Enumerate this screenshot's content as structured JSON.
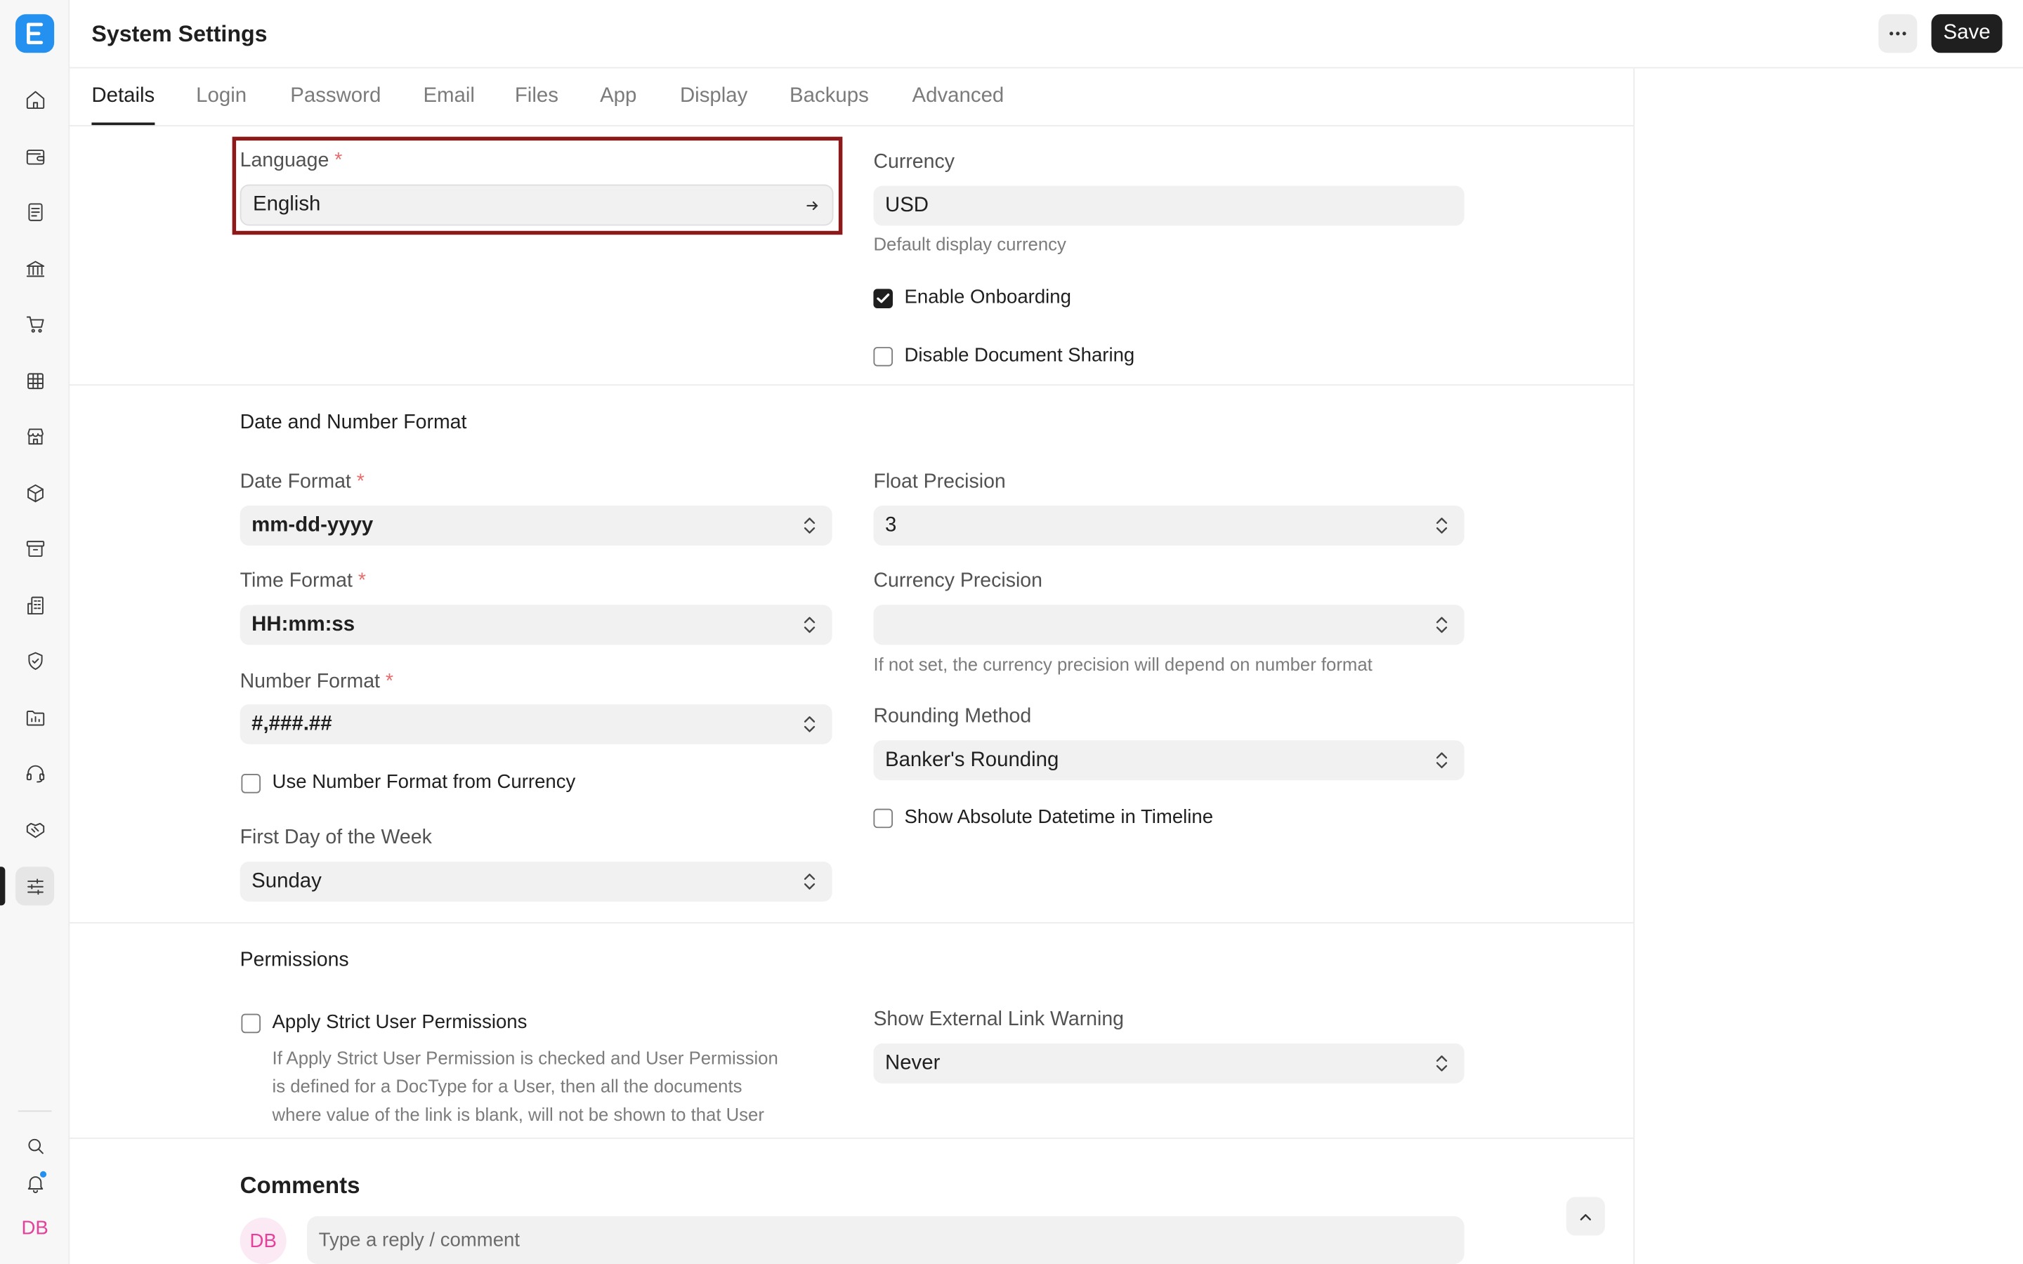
{
  "header": {
    "title": "System Settings",
    "more_label": "···",
    "save_label": "Save"
  },
  "sidebar": {
    "items": [
      {
        "icon": "home-icon"
      },
      {
        "icon": "wallet-icon"
      },
      {
        "icon": "document-icon"
      },
      {
        "icon": "bank-icon"
      },
      {
        "icon": "cart-icon"
      },
      {
        "icon": "table-icon"
      },
      {
        "icon": "store-icon"
      },
      {
        "icon": "package-icon"
      },
      {
        "icon": "archive-icon"
      },
      {
        "icon": "building-icon"
      },
      {
        "icon": "shield-icon"
      },
      {
        "icon": "folder-chart-icon"
      },
      {
        "icon": "headset-icon"
      },
      {
        "icon": "handshake-icon"
      },
      {
        "icon": "settings-sliders-icon",
        "active": true
      }
    ],
    "bottom": [
      "search-icon",
      "bell-icon"
    ],
    "user_initials": "DB"
  },
  "tabs": [
    "Details",
    "Login",
    "Password",
    "Email",
    "Files",
    "App",
    "Display",
    "Backups",
    "Advanced"
  ],
  "active_tab": "Details",
  "details": {
    "language": {
      "label": "Language",
      "required": "*",
      "value": "English"
    },
    "currency": {
      "label": "Currency",
      "value": "USD",
      "help": "Default display currency"
    },
    "enable_onboarding": {
      "label": "Enable Onboarding",
      "checked": true
    },
    "disable_document_sharing": {
      "label": "Disable Document Sharing",
      "checked": false
    }
  },
  "date_number_format": {
    "title": "Date and Number Format",
    "date_format": {
      "label": "Date Format",
      "required": "*",
      "value": "mm-dd-yyyy"
    },
    "time_format": {
      "label": "Time Format",
      "required": "*",
      "value": "HH:mm:ss"
    },
    "number_format": {
      "label": "Number Format",
      "required": "*",
      "value": "#,###.##"
    },
    "use_number_format_from_currency": {
      "label": "Use Number Format from Currency",
      "checked": false
    },
    "first_day_of_week": {
      "label": "First Day of the Week",
      "value": "Sunday"
    },
    "float_precision": {
      "label": "Float Precision",
      "value": "3"
    },
    "currency_precision": {
      "label": "Currency Precision",
      "value": "",
      "help": "If not set, the currency precision will depend on number format"
    },
    "rounding_method": {
      "label": "Rounding Method",
      "value": "Banker's Rounding"
    },
    "show_absolute_datetime": {
      "label": "Show Absolute Datetime in Timeline",
      "checked": false
    }
  },
  "permissions": {
    "title": "Permissions",
    "apply_strict": {
      "label": "Apply Strict User Permissions",
      "checked": false,
      "help": [
        "If Apply Strict User Permission is checked and User Permission",
        "is defined for a DocType for a User, then all the documents",
        "where value of the link is blank, will not be shown to that User"
      ]
    },
    "external_link_warning": {
      "label": "Show External Link Warning",
      "value": "Never"
    }
  },
  "comments": {
    "title": "Comments",
    "avatar_initials": "DB",
    "placeholder": "Type a reply / comment"
  },
  "colors": {
    "accent": "#2490ef",
    "primary_button": "#1f1f1f",
    "highlight_border": "#8c1a1a",
    "required_marker": "#e86c6c",
    "avatar_pink": "#e4419a"
  }
}
